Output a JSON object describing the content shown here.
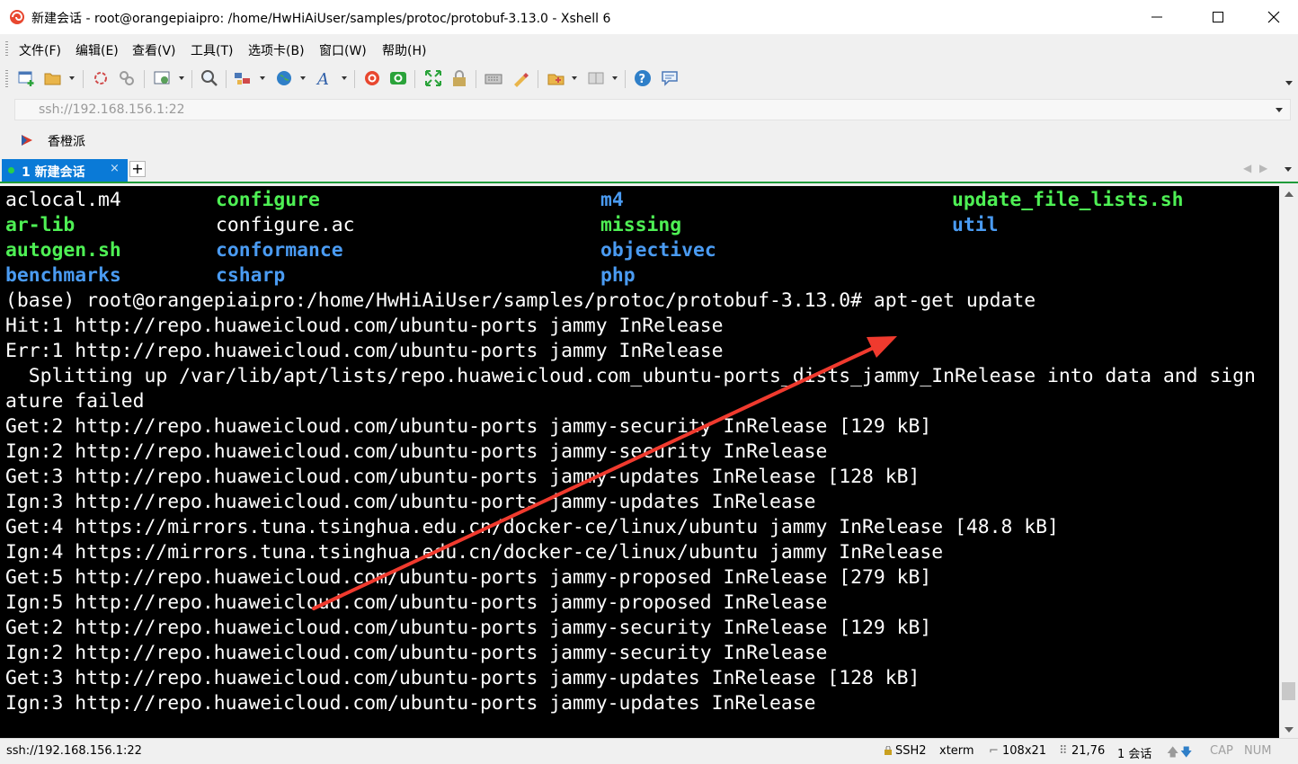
{
  "window": {
    "title": "新建会话 - root@orangepiaipro: /home/HwHiAiUser/samples/protoc/protobuf-3.13.0 - Xshell 6",
    "controls": [
      "minimize-icon",
      "maximize-icon",
      "close-icon"
    ]
  },
  "menu": {
    "items": [
      "文件(F)",
      "编辑(E)",
      "查看(V)",
      "工具(T)",
      "选项卡(B)",
      "窗口(W)",
      "帮助(H)"
    ]
  },
  "toolbar": {
    "icons": [
      "new-session-icon",
      "open-folder-icon",
      "reconnect-icon",
      "disconnect-icon",
      "properties-icon",
      "find-icon",
      "transfer-icon",
      "globe-icon",
      "font-icon",
      "xshell-icon",
      "xftp-icon",
      "fullscreen-icon",
      "lock-icon",
      "keyboard-icon",
      "highlight-icon",
      "compose-icon",
      "layout-icon",
      "help-icon",
      "chat-icon"
    ]
  },
  "address": {
    "value": "ssh://192.168.156.1:22"
  },
  "links": {
    "items": [
      "香橙派"
    ]
  },
  "tabs": {
    "items": [
      {
        "label": "1 新建会话",
        "close": "×"
      }
    ],
    "add": "+",
    "prev": "◀",
    "next": "▶"
  },
  "terminal": {
    "listing": [
      [
        "aclocal.m4",
        "configure",
        "m4",
        "update_file_lists.sh"
      ],
      [
        "ar-lib",
        "configure.ac",
        "missing",
        "util"
      ],
      [
        "autogen.sh",
        "conformance",
        "objectivec",
        ""
      ],
      [
        "benchmarks",
        "csharp",
        "php",
        ""
      ]
    ],
    "lines": [
      "(base) root@orangepiaipro:/home/HwHiAiUser/samples/protoc/protobuf-3.13.0# apt-get update",
      "Hit:1 http://repo.huaweicloud.com/ubuntu-ports jammy InRelease",
      "Err:1 http://repo.huaweicloud.com/ubuntu-ports jammy InRelease",
      "  Splitting up /var/lib/apt/lists/repo.huaweicloud.com_ubuntu-ports_dists_jammy_InRelease into data and sign",
      "ature failed",
      "Get:2 http://repo.huaweicloud.com/ubuntu-ports jammy-security InRelease [129 kB]",
      "Ign:2 http://repo.huaweicloud.com/ubuntu-ports jammy-security InRelease",
      "Get:3 http://repo.huaweicloud.com/ubuntu-ports jammy-updates InRelease [128 kB]",
      "Ign:3 http://repo.huaweicloud.com/ubuntu-ports jammy-updates InRelease",
      "Get:4 https://mirrors.tuna.tsinghua.edu.cn/docker-ce/linux/ubuntu jammy InRelease [48.8 kB]",
      "Ign:4 https://mirrors.tuna.tsinghua.edu.cn/docker-ce/linux/ubuntu jammy InRelease",
      "Get:5 http://repo.huaweicloud.com/ubuntu-ports jammy-proposed InRelease [279 kB]",
      "Ign:5 http://repo.huaweicloud.com/ubuntu-ports jammy-proposed InRelease",
      "Get:2 http://repo.huaweicloud.com/ubuntu-ports jammy-security InRelease [129 kB]",
      "Ign:2 http://repo.huaweicloud.com/ubuntu-ports jammy-security InRelease",
      "Get:3 http://repo.huaweicloud.com/ubuntu-ports jammy-updates InRelease [128 kB]",
      "Ign:3 http://repo.huaweicloud.com/ubuntu-ports jammy-updates InRelease"
    ]
  },
  "status": {
    "address": "ssh://192.168.156.1:22",
    "protocol": "SSH2",
    "terminal_type": "xterm",
    "size": "108x21",
    "cursor": "21,76",
    "sessions": "1 会话",
    "caps": "CAP",
    "num": "NUM"
  },
  "colors": {
    "terminal_bg": "#000000",
    "terminal_fg": "#ffffff",
    "exec_green": "#4ef054",
    "dir_blue": "#4a9bf2",
    "annotation_arrow": "#f03a2e",
    "tab_active": "#0a7ad7"
  }
}
